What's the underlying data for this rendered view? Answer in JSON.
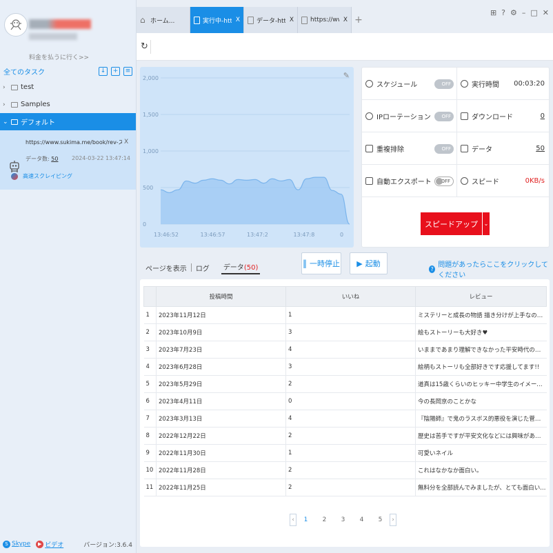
{
  "sidebar": {
    "pay_link": "料金を払うに行く>>",
    "all_tasks": "全てのタスク",
    "folders": [
      {
        "label": "test"
      },
      {
        "label": "Samples"
      },
      {
        "label": "デフォルト"
      }
    ],
    "task": {
      "url": "https://www.sukima.me/book/rev-スクレイピ...",
      "data_label": "データ数:",
      "data_count": "50",
      "date": "2024-03-22 13:47:14",
      "mode": "高速スクレイピング"
    },
    "footer": {
      "skype": "Skype",
      "video": "ビデオ",
      "version": "バージョン:3.6.4"
    }
  },
  "tabs": [
    {
      "label": "ホーム..."
    },
    {
      "label": "実行中-http..."
    },
    {
      "label": "データ-http..."
    },
    {
      "label": "https://www...."
    }
  ],
  "chart_data": {
    "type": "area",
    "title": "",
    "x_ticks": [
      "13:46:52",
      "13:46:57",
      "13:47:2",
      "13:47:8",
      "0"
    ],
    "y_ticks": [
      "0",
      "500",
      "1,000",
      "1,500",
      "2,000"
    ],
    "ylim": [
      0,
      2000
    ],
    "series": [
      {
        "values": [
          470,
          430,
          470,
          590,
          560,
          600,
          620,
          600,
          550,
          610,
          600,
          610,
          560,
          620,
          590,
          610,
          470,
          620,
          640,
          640,
          460,
          410,
          0
        ]
      }
    ],
    "color": "#9cc8f3"
  },
  "stats": {
    "schedule": "スケジュール",
    "schedule_state": "OFF",
    "runtime": "実行時間",
    "runtime_val": "00:03:20",
    "ip": "IPローテーション",
    "ip_state": "OFF",
    "download": "ダウンロード",
    "download_val": "0",
    "dedupe": "重複排除",
    "dedupe_state": "OFF",
    "data": "データ",
    "data_val": "50",
    "export": "自動エクスポート",
    "export_state": "OFF",
    "speed": "スピード",
    "speed_val": "0KB/s",
    "speedup": "スピードアップ"
  },
  "subtabs": {
    "page": "ページを表示",
    "log": "ログ",
    "data": "データ",
    "data_count": "(50)"
  },
  "buttons": {
    "pause": "一時停止",
    "start": "起動"
  },
  "help": "問題があったらここをクリックしてください",
  "table": {
    "headers": [
      "投稿時間",
      "いいね",
      "レビュー"
    ],
    "rows": [
      [
        "1",
        "2023年11月12日",
        "1",
        "ミステリーと成長の物語 描き分けが上手なので、たくさん..."
      ],
      [
        "2",
        "2023年10月9日",
        "3",
        "絵もストーリーも大好き♥"
      ],
      [
        "3",
        "2023年7月23日",
        "4",
        "いままであまり理解できなかった平安時代の、菅原道真と同..."
      ],
      [
        "4",
        "2023年6月28日",
        "3",
        "絵柄もストーリも全部好きです応援してます!!"
      ],
      [
        "5",
        "2023年5月29日",
        "2",
        "道真は15歳くらいのヒッキー中学生のイメージで読んでた..."
      ],
      [
        "6",
        "2023年4月11日",
        "0",
        "今の長岡京のことかな"
      ],
      [
        "7",
        "2023年3月13日",
        "4",
        "『陰陽師』で鬼のラスボス的悪役を演じた菅原道真の少年時..."
      ],
      [
        "8",
        "2022年12月22日",
        "2",
        "歴史は苦手ですが平安文化などには興味があり解説もあって..."
      ],
      [
        "9",
        "2022年11月30日",
        "1",
        "可愛いネイル"
      ],
      [
        "10",
        "2022年11月28日",
        "2",
        "これはなかなか面白い。"
      ],
      [
        "11",
        "2022年11月25日",
        "2",
        "無料分を全部読んでみましたが、とても面白いです!"
      ]
    ]
  },
  "pager": [
    "1",
    "2",
    "3",
    "4",
    "5"
  ]
}
